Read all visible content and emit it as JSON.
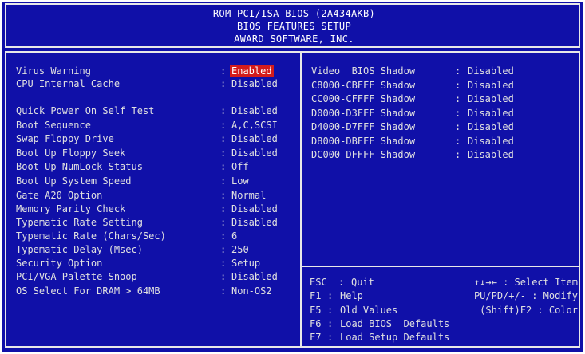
{
  "header": {
    "line1": "ROM PCI/ISA BIOS (2A434AKB)",
    "line2": "BIOS FEATURES SETUP",
    "line3": "AWARD SOFTWARE, INC."
  },
  "left_items": [
    {
      "label": "Virus Warning",
      "value": "Enabled",
      "selected": true
    },
    {
      "label": "CPU Internal Cache",
      "value": "Disabled"
    },
    {
      "label": "Quick Power On Self Test",
      "value": "Disabled"
    },
    {
      "label": "Boot Sequence",
      "value": "A,C,SCSI"
    },
    {
      "label": "Swap Floppy Drive",
      "value": "Disabled"
    },
    {
      "label": "Boot Up Floppy Seek",
      "value": "Disabled"
    },
    {
      "label": "Boot Up NumLock Status",
      "value": "Off"
    },
    {
      "label": "Boot Up System Speed",
      "value": "Low"
    },
    {
      "label": "Gate A20 Option",
      "value": "Normal"
    },
    {
      "label": "Memory Parity Check",
      "value": "Disabled"
    },
    {
      "label": "Typematic Rate Setting",
      "value": "Disabled"
    },
    {
      "label": "Typematic Rate (Chars/Sec)",
      "value": "6"
    },
    {
      "label": "Typematic Delay (Msec)",
      "value": "250"
    },
    {
      "label": "Security Option",
      "value": "Setup"
    },
    {
      "label": "PCI/VGA Palette Snoop",
      "value": "Disabled"
    },
    {
      "label": "OS Select For DRAM > 64MB",
      "value": "Non-OS2"
    }
  ],
  "separator": ":",
  "right_items": [
    {
      "label": "Video  BIOS Shadow",
      "value": "Disabled"
    },
    {
      "label": "C8000-CBFFF Shadow",
      "value": "Disabled"
    },
    {
      "label": "CC000-CFFFF Shadow",
      "value": "Disabled"
    },
    {
      "label": "D0000-D3FFF Shadow",
      "value": "Disabled"
    },
    {
      "label": "D4000-D7FFF Shadow",
      "value": "Disabled"
    },
    {
      "label": "D8000-DBFFF Shadow",
      "value": "Disabled"
    },
    {
      "label": "DC000-DFFFF Shadow",
      "value": "Disabled"
    }
  ],
  "help_keys": [
    {
      "key": "ESC",
      "desc": "Quit",
      "right": "↑↓→← : Select Item"
    },
    {
      "key": "F1",
      "desc": "Help",
      "right": "PU/PD/+/- : Modify"
    },
    {
      "key": "F5",
      "desc": "Old Values",
      "right": "(Shift)F2 : Color"
    },
    {
      "key": "F6",
      "desc": "Load BIOS  Defaults",
      "right": ""
    },
    {
      "key": "F7",
      "desc": "Load Setup Defaults",
      "right": ""
    }
  ],
  "colors": {
    "background": "#1010a8",
    "text": "#e0e0e0",
    "selection": "#d41c1c"
  }
}
